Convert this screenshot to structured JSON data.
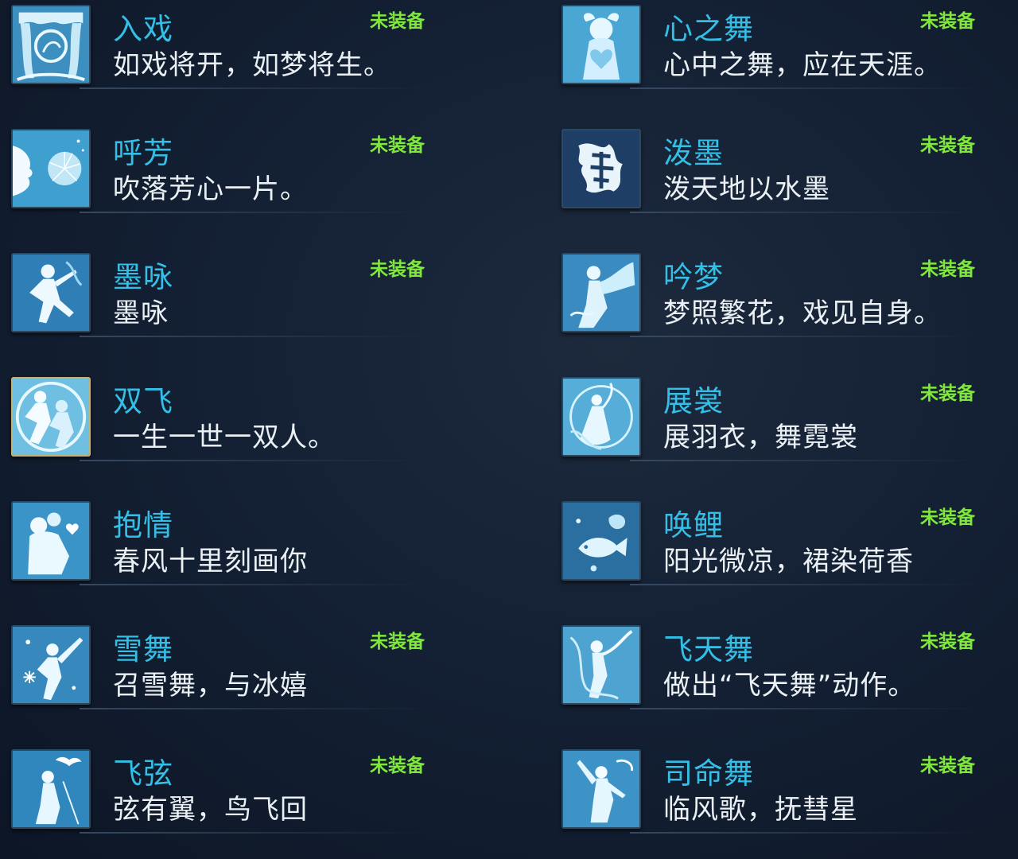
{
  "colors": {
    "skill_name": "#33bfe6",
    "description": "#eaf0f4",
    "status": "#7fe83b",
    "background": "#142034"
  },
  "skills": [
    {
      "name": "入戏",
      "desc": "如戏将开，如梦将生。",
      "status": "未装备",
      "icon": "stage-curtain-icon"
    },
    {
      "name": "心之舞",
      "desc": "心中之舞，应在天涯。",
      "status": "未装备",
      "icon": "heart-dancer-icon"
    },
    {
      "name": "呼芳",
      "desc": "吹落芳心一片。",
      "status": "未装备",
      "icon": "dandelion-blow-icon"
    },
    {
      "name": "泼墨",
      "desc": "泼天地以水墨",
      "status": "未装备",
      "icon": "ink-splash-icon"
    },
    {
      "name": "墨咏",
      "desc": "墨咏",
      "status": "未装备",
      "icon": "ink-poet-icon"
    },
    {
      "name": "吟梦",
      "desc": "梦照繁花，戏见自身。",
      "status": "未装备",
      "icon": "dreaming-dancer-icon"
    },
    {
      "name": "双飞",
      "desc": "一生一世一双人。",
      "status": "",
      "icon": "couple-flying-icon"
    },
    {
      "name": "展裳",
      "desc": "展羽衣，舞霓裳",
      "status": "未装备",
      "icon": "feather-robe-icon"
    },
    {
      "name": "抱情",
      "desc": "春风十里刻画你",
      "status": "",
      "icon": "embrace-heart-icon"
    },
    {
      "name": "唤鲤",
      "desc": "阳光微凉，裙染荷香",
      "status": "未装备",
      "icon": "koi-fish-icon"
    },
    {
      "name": "雪舞",
      "desc": "召雪舞，与冰嬉",
      "status": "未装备",
      "icon": "snow-dance-icon"
    },
    {
      "name": "飞天舞",
      "desc": "做出“飞天舞”动作。",
      "status": "未装备",
      "icon": "flying-apsara-icon"
    },
    {
      "name": "飞弦",
      "desc": "弦有翼，鸟飞回",
      "status": "未装备",
      "icon": "bird-string-icon"
    },
    {
      "name": "司命舞",
      "desc": "临风歌，抚彗星",
      "status": "未装备",
      "icon": "fate-dancer-icon"
    }
  ]
}
